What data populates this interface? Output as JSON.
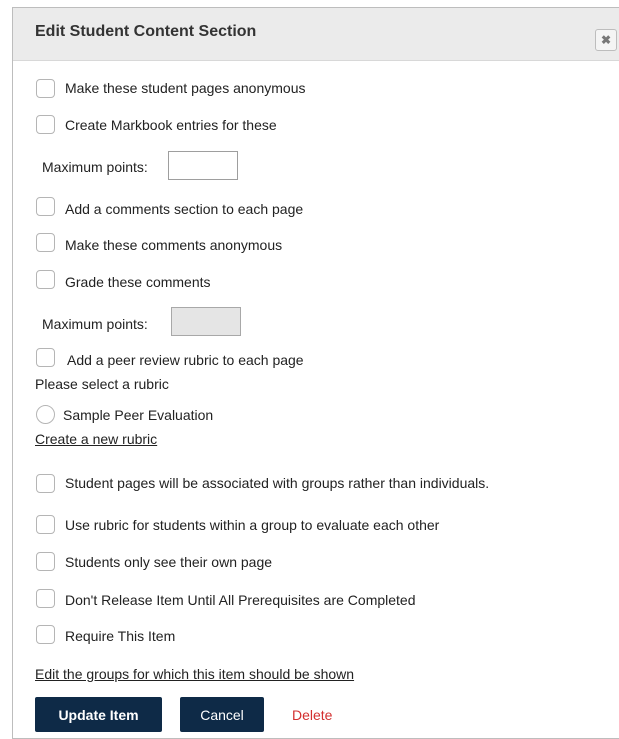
{
  "dialog": {
    "title": "Edit Student Content Section",
    "close_glyph": "✖"
  },
  "options": {
    "anonymous_pages": "Make these student pages anonymous",
    "markbook_entries": "Create Markbook entries for these",
    "max_points_label_1": "Maximum points:",
    "max_points_value_1": "",
    "comments_section": "Add a comments section to each page",
    "anonymous_comments": "Make these comments anonymous",
    "grade_comments": "Grade these comments",
    "max_points_label_2": "Maximum points:",
    "max_points_value_2": "",
    "peer_review": "Add a peer review rubric to each page",
    "select_rubric_prompt": "Please select a rubric",
    "rubric_option": "Sample Peer Evaluation",
    "create_rubric_link": "Create a new rubric",
    "group_pages": "Student pages will be associated with groups rather than individuals.",
    "group_rubric": "Use rubric for students within a group to evaluate each other",
    "own_page_only": "Students only see their own page",
    "dont_release": "Don't Release Item Until All Prerequisites are Completed",
    "require_item": "Require This Item",
    "edit_groups_link": "Edit the groups for which this item should be shown"
  },
  "actions": {
    "update": "Update Item",
    "cancel": "Cancel",
    "delete": "Delete"
  },
  "colors": {
    "button_bg": "#0e2a47",
    "delete_text": "#d32f2f",
    "titlebar_bg": "#ebebeb"
  }
}
